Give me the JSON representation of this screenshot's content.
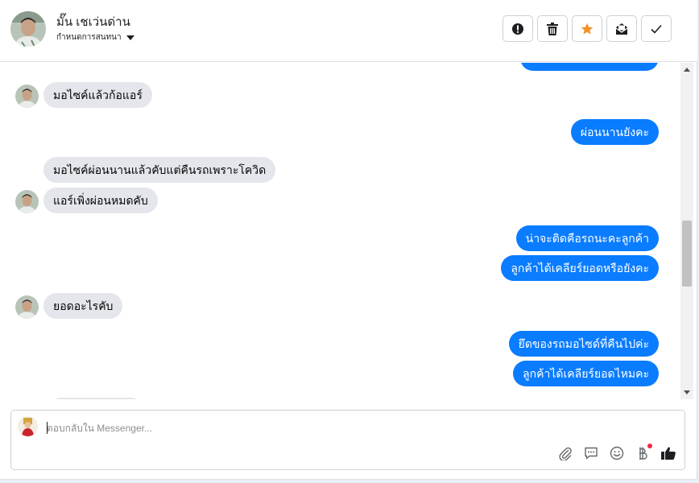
{
  "header": {
    "contact_name": "มั๊น เชเว่นด่าน",
    "assign_label": "กำหนดการสนทนา",
    "buttons": [
      {
        "name": "spam-button",
        "icon": "exclamation-icon"
      },
      {
        "name": "delete-button",
        "icon": "trash-icon"
      },
      {
        "name": "star-button",
        "icon": "star-icon",
        "color": "#f0932b"
      },
      {
        "name": "mark-unread-button",
        "icon": "envelope-icon"
      },
      {
        "name": "done-button",
        "icon": "check-icon"
      }
    ]
  },
  "messages": {
    "m1": "มอไซค์แล้วก้อแอร์",
    "m2": "ผ่อนนานยังคะ",
    "m3": "มอไซค์ผ่อนนานแล้วคับแต่คืนรถเพราะโควิด",
    "m4": "แอร์เพิ่งผ่อนหมดคับ",
    "m5": "น่าจะติดคือรถนะคะลูกค้า",
    "m6": "ลูกค้าได้เคลียร์ยอดหรือยังคะ",
    "m7": "ยอดอะไรคับ",
    "m8": "ยึดของรถมอไซด์ที่คืนไปค่ะ",
    "m9": "ลูกค้าได้เคลียร์ยอดไหมคะ"
  },
  "composer": {
    "placeholder": "ตอบกลับใน Messenger...",
    "icons": [
      "paperclip-icon",
      "saved-reply-icon",
      "emoji-icon",
      "payment-icon",
      "like-icon"
    ]
  },
  "colors": {
    "outgoing_bubble": "#0a7cff",
    "incoming_bubble": "#e4e6eb",
    "star": "#f0932b"
  }
}
